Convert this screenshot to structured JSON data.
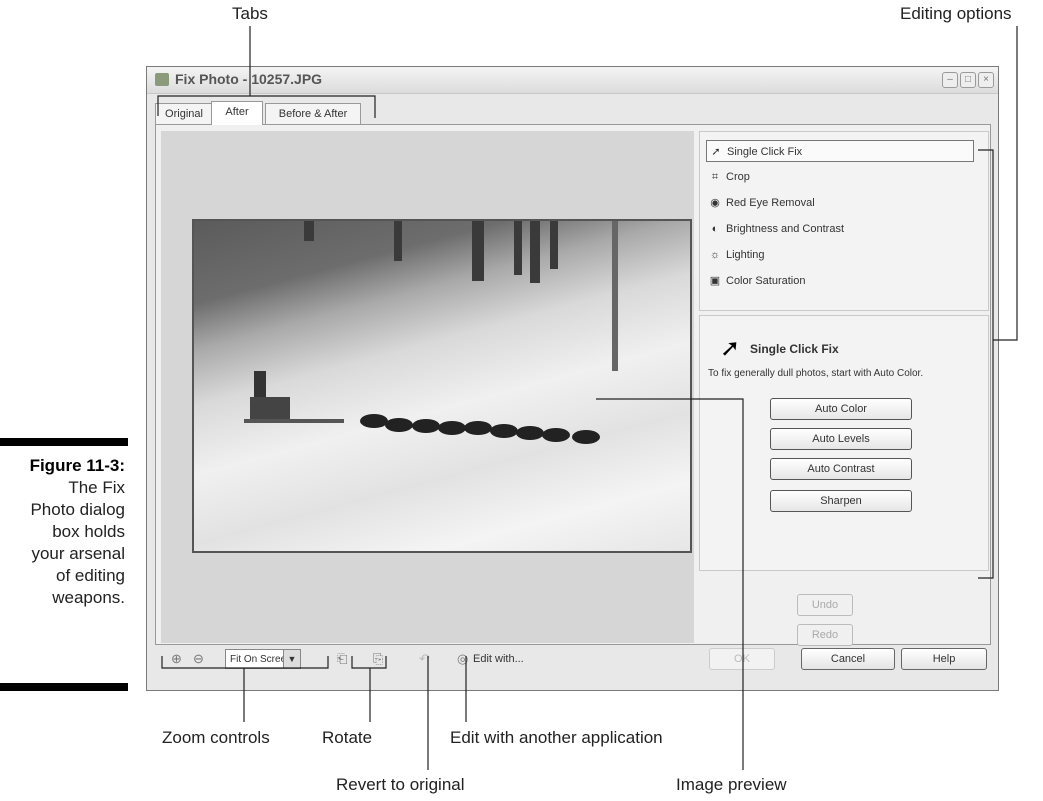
{
  "window": {
    "title": "Fix Photo - 10257.JPG"
  },
  "tabs": [
    "Original",
    "After",
    "Before & After"
  ],
  "options": {
    "items": [
      {
        "label": "Single Click Fix",
        "icon": "cursor-icon"
      },
      {
        "label": "Crop",
        "icon": "crop-icon"
      },
      {
        "label": "Red Eye Removal",
        "icon": "eye-icon"
      },
      {
        "label": "Brightness and Contrast",
        "icon": "brightness-icon"
      },
      {
        "label": "Lighting",
        "icon": "lighting-icon"
      },
      {
        "label": "Color Saturation",
        "icon": "saturation-icon"
      }
    ]
  },
  "detail": {
    "heading": "Single Click Fix",
    "description": "To fix generally dull photos, start with Auto Color.",
    "buttons": [
      "Auto Color",
      "Auto Levels",
      "Auto Contrast",
      "Sharpen"
    ]
  },
  "history": {
    "undo": "Undo",
    "redo": "Redo"
  },
  "toolbar": {
    "zoom_value": "Fit On Screen",
    "edit_with": "Edit with...",
    "ok": "OK",
    "cancel": "Cancel",
    "help": "Help"
  },
  "callouts": {
    "tabs": "Tabs",
    "editing_options": "Editing options",
    "zoom_controls": "Zoom controls",
    "rotate": "Rotate",
    "edit_with_app": "Edit with another application",
    "revert": "Revert to original",
    "image_preview": "Image preview"
  },
  "figure": {
    "label": "Figure 11-3:",
    "caption_lines": [
      "The Fix",
      "Photo dialog",
      "box holds",
      "your arsenal",
      "of editing",
      "weapons."
    ]
  }
}
